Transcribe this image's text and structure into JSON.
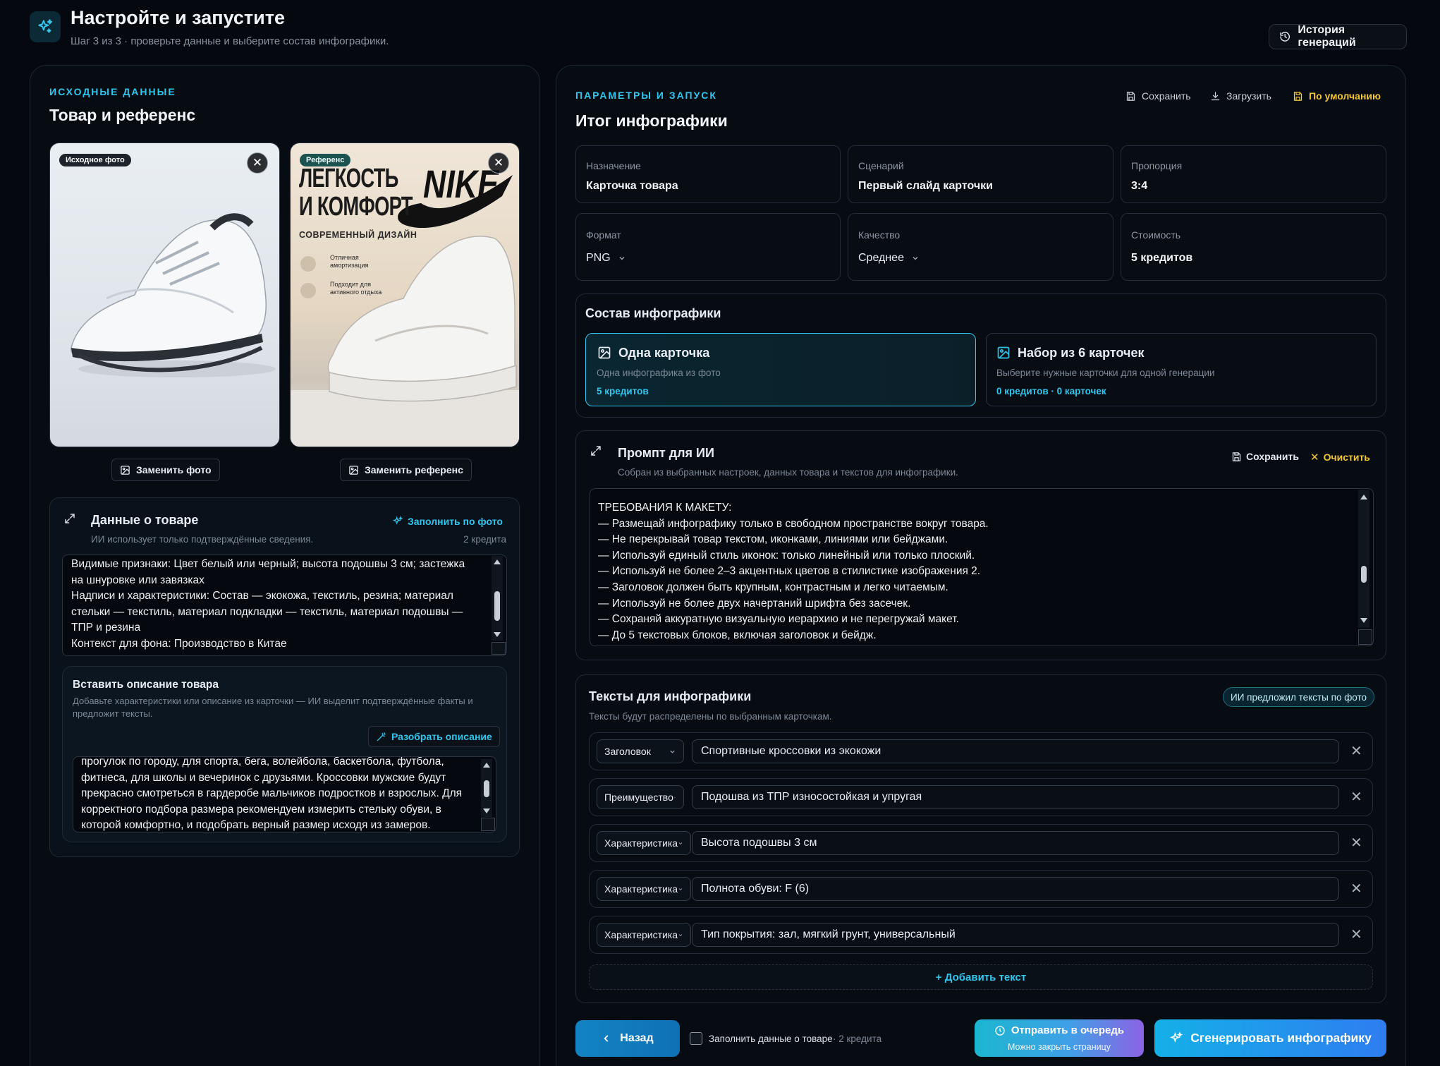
{
  "header": {
    "title": "Настройте и запустите",
    "subtitle": "Шаг 3 из 3 · проверьте данные и выберите состав инфографики.",
    "history_label": "История генераций"
  },
  "left": {
    "section_label": "ИСХОДНЫЕ ДАННЫЕ",
    "section_title": "Товар и референс",
    "photo_tag": "Исходное фото",
    "reference_tag": "Референс",
    "replace_photo": "Заменить фото",
    "replace_reference": "Заменить референс",
    "reference_image": {
      "headline1": "ЛЕГКОСТЬ",
      "headline2": "И КОМФОРТ",
      "subhead": "СОВРЕМЕННЫЙ ДИЗАЙН",
      "brand": "NIKE",
      "feature1": "Отличная амортизация",
      "feature2": "Подходит для активного отдыха"
    },
    "product_data": {
      "title": "Данные о товаре",
      "subtitle": "ИИ использует только подтверждённые сведения.",
      "fill_label": "Заполнить по фото",
      "credits": "2 кредита",
      "lines": [
        "Видимые признаки: Цвет белый или черный; высота подошвы 3 см; застежка",
        "на шнуровке или завязках",
        "Надписи и характеристики: Состав — экокожа, текстиль, резина; материал",
        "стельки — текстиль, материал подкладки — текстиль, материал подошвы —",
        "ТПР и резина",
        "Контекст для фона: Производство в Китае"
      ]
    },
    "description": {
      "title": "Вставить описание товара",
      "hint_line1": "Добавьте характеристики или описание из карточки — ИИ выделит подтверждённые факты и",
      "hint_line2": "предложит тексты.",
      "parse_label": "Разобрать описание",
      "lines": [
        "прогулок по городу, для спорта, бега, волейбола, баскетбола, футбола,",
        "фитнеса, для школы и вечеринок с друзьями. Кроссовки мужские будут",
        "прекрасно смотреться в гардеробе мальчиков подростков и взрослых. Для",
        "корректного подбора размера рекомендуем измерить стельку обуви, в",
        "которой комфортно, и подобрать верный размер исходя из замеров."
      ]
    }
  },
  "right": {
    "section_label": "ПАРАМЕТРЫ И ЗАПУСК",
    "section_title": "Итог инфографики",
    "save": "Сохранить",
    "load": "Загрузить",
    "defaults": "По умолчанию",
    "params": [
      {
        "label": "Назначение",
        "value": "Карточка товара"
      },
      {
        "label": "Сценарий",
        "value": "Первый слайд карточки"
      },
      {
        "label": "Пропорция",
        "value": "3:4"
      },
      {
        "label": "Формат",
        "value": "PNG"
      },
      {
        "label": "Качество",
        "value": "Среднее"
      },
      {
        "label": "Стоимость",
        "value": "5 кредитов"
      }
    ],
    "composition": {
      "title": "Состав инфографики",
      "options": [
        {
          "title": "Одна карточка",
          "desc": "Одна инфографика из фото",
          "price": "5 кредитов"
        },
        {
          "title": "Набор из 6 карточек",
          "desc": "Выберите нужные карточки для одной генерации",
          "price": "0 кредитов · 0 карточек"
        }
      ]
    },
    "prompt": {
      "title": "Промпт для ИИ",
      "subtitle": "Собран из выбранных настроек, данных товара и текстов для инфографики.",
      "save": "Сохранить",
      "clear": "Очистить",
      "lines": [
        "ТРЕБОВАНИЯ К МАКЕТУ:",
        "— Размещай инфографику только в свободном пространстве вокруг товара.",
        "— Не перекрывай товар текстом, иконками, линиями или бейджами.",
        "— Используй единый стиль иконок: только линейный или только плоский.",
        "— Используй не более 2–3 акцентных цветов в стилистике изображения 2.",
        "— Заголовок должен быть крупным, контрастным и легко читаемым.",
        "— Используй не более двух начертаний шрифта без засечек.",
        "— Сохраняй аккуратную визуальную иерархию и не перегружай макет.",
        "— До 5 текстовых блоков, включая заголовок и бейдж."
      ]
    },
    "texts": {
      "title": "Тексты для инфографики",
      "subtitle": "Тексты будут распределены по выбранным карточкам.",
      "ai_badge": "ИИ предложил тексты по фото",
      "add": "+ Добавить текст",
      "rows": [
        {
          "type": "Заголовок",
          "value": "Спортивные кроссовки из экокожи"
        },
        {
          "type": "Преимущество",
          "value": "Подошва из ТПР износостойкая и упругая"
        },
        {
          "type": "Характеристика",
          "value": "Высота подошвы 3 см"
        },
        {
          "type": "Характеристика",
          "value": "Полнота обуви: F (6)"
        },
        {
          "type": "Характеристика",
          "value": "Тип покрытия: зал, мягкий грунт, универсальный"
        }
      ]
    }
  },
  "footer": {
    "back": "Назад",
    "fill_checkbox": "Заполнить данные о товаре",
    "fill_credits": "· 2 кредита",
    "queue": "Отправить в очередь",
    "queue_sub": "Можно закрыть страницу",
    "generate": "Сгенерировать инфографику"
  },
  "colors": {
    "accent": "#31c6ee",
    "warning": "#f3c63a",
    "background": "#05080e"
  }
}
